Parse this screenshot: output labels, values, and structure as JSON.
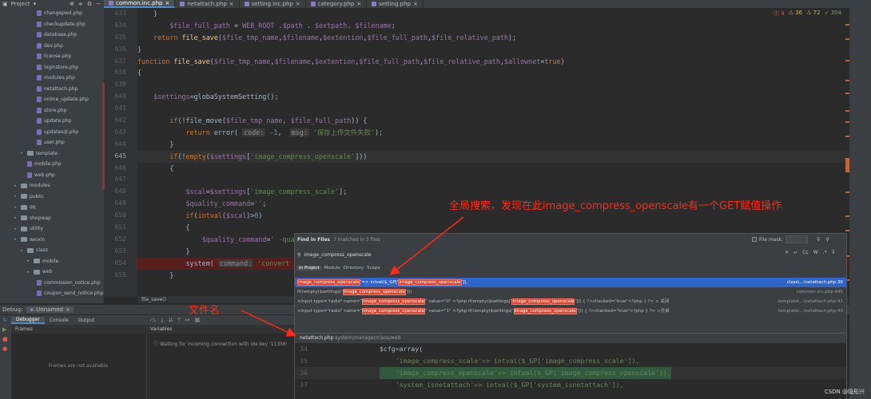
{
  "project_label": "Project",
  "tabs": [
    {
      "label": "common.inc.php",
      "active": true
    },
    {
      "label": "netattach.php",
      "active": false
    },
    {
      "label": "setting.inc.php",
      "active": false
    },
    {
      "label": "category.php",
      "active": false
    },
    {
      "label": "setting.php",
      "active": false
    }
  ],
  "tree": [
    {
      "label": "changepwd.php",
      "type": "file",
      "indent": 46
    },
    {
      "label": "checkupdate.php",
      "type": "file",
      "indent": 46
    },
    {
      "label": "database.php",
      "type": "file",
      "indent": 46
    },
    {
      "label": "dev.php",
      "type": "file",
      "indent": 46
    },
    {
      "label": "license.php",
      "type": "file",
      "indent": 46
    },
    {
      "label": "loginstore.php",
      "type": "file",
      "indent": 46
    },
    {
      "label": "modules.php",
      "type": "file",
      "indent": 46
    },
    {
      "label": "netattach.php",
      "type": "file",
      "indent": 46
    },
    {
      "label": "online_update.php",
      "type": "file",
      "indent": 46
    },
    {
      "label": "store.php",
      "type": "file",
      "indent": 46
    },
    {
      "label": "update.php",
      "type": "file",
      "indent": 46
    },
    {
      "label": "updatesql.php",
      "type": "file",
      "indent": 46
    },
    {
      "label": "user.php",
      "type": "file",
      "indent": 46
    },
    {
      "label": "template",
      "type": "dir",
      "indent": 26
    },
    {
      "label": "mobile.php",
      "type": "file",
      "indent": 34
    },
    {
      "label": "web.php",
      "type": "file",
      "indent": 34
    },
    {
      "label": "modules",
      "type": "dir",
      "indent": 18
    },
    {
      "label": "public",
      "type": "dir",
      "indent": 18
    },
    {
      "label": "qq",
      "type": "dir",
      "indent": 18
    },
    {
      "label": "shopwap",
      "type": "dir",
      "indent": 18
    },
    {
      "label": "utility",
      "type": "dir",
      "indent": 18
    },
    {
      "label": "weixin",
      "type": "dir",
      "indent": 18
    },
    {
      "label": "class",
      "type": "dir",
      "indent": 26
    },
    {
      "label": "mobile",
      "type": "dir",
      "indent": 34
    },
    {
      "label": "web",
      "type": "dir",
      "indent": 34
    },
    {
      "label": "commission_notice.php",
      "type": "file",
      "indent": 46
    },
    {
      "label": "coupon_send_notice.php",
      "type": "file",
      "indent": 46
    }
  ],
  "line_numbers": [
    "633",
    "634",
    "635",
    "636",
    "637",
    "638",
    "639",
    "640",
    "641",
    "642",
    "643",
    "644",
    "645",
    "646",
    "647",
    "648",
    "649",
    "650",
    "651",
    "652",
    "653",
    "654",
    "655"
  ],
  "current_line": "645",
  "inspections": {
    "errors": "4",
    "warnings": "36",
    "weak": "72",
    "ok": "304"
  },
  "breadcrumb": "file_save()",
  "debug": {
    "label": "Debug:",
    "session": "Unnamed",
    "tabs": [
      "Debugger",
      "Console",
      "Output"
    ],
    "frames_header": "Frames",
    "frames_empty": "Frames are not available",
    "variables_header": "Variables",
    "waiting_msg": "Waiting for incoming connection with ide key '11336'"
  },
  "find": {
    "title": "Find in Files",
    "count": "7 matches in 3 files",
    "file_mask_label": "File mask:",
    "query": "image_compress_openscale",
    "scopes": [
      "In Project",
      "Module",
      "Directory",
      "Scope"
    ],
    "options": [
      "Cc",
      "W",
      ".*"
    ],
    "results": [
      {
        "pre": "",
        "match": "image_compress_openscale",
        "mid": "'=> intval($_GP['",
        "match2": "image_compress_openscale",
        "post": "']),",
        "location": "class\\...\\netattach.php 36"
      },
      {
        "pre": "if(!empty($settings['",
        "match": "image_compress_openscale",
        "mid": "']))",
        "match2": "",
        "post": "",
        "location": "common.inc.php 645"
      },
      {
        "pre": "<input type=\"radio\" name=\"",
        "match": "image_compress_openscale",
        "mid": "\" value=\"0\" <?php if(empty($settings['",
        "match2": "image_compress_openscale",
        "post": "'])) { ?>checked=\"true\"<?php } ?> > 关闭",
        "location": "template\\...\\netattach.php 41"
      },
      {
        "pre": "<input type=\"radio\" name=\"",
        "match": "image_compress_openscale",
        "mid": "\" value=\"1\" <?php if(!empty($settings['",
        "match2": "image_compress_openscale",
        "post": "'])) { ?>checked=\"true\"<?php } ?> >开启",
        "location": "template\\...\\netattach.php 43"
      }
    ],
    "preview_file": "netattach.php",
    "preview_path": "system/manager/class/web",
    "preview_lines": [
      {
        "n": "34",
        "text": "$cfg=array("
      },
      {
        "n": "35",
        "text": "    'image_compress_scale'=> intval($_GP['image_compress_scale']),"
      },
      {
        "n": "36",
        "text": "    'image_compress_openscale'=> intval($_GP['image_compress_openscale']),"
      },
      {
        "n": "37",
        "text": "    'system_isnetattach'=> intval($_GP['system_isnetattach']),"
      }
    ]
  },
  "annotations": {
    "search_note": "全局搜索，发现在此image_compress_openscale有一个GET赋值操作",
    "file_note": "文件名"
  },
  "watermark": "CSDN @隐形兴",
  "colors": {
    "annotation": "#ff2a1a",
    "highlight": "#e5432a",
    "accent": "#4a88c7"
  }
}
